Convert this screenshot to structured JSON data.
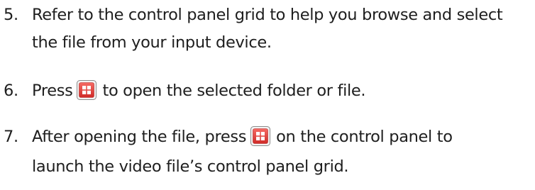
{
  "steps": [
    {
      "number": "5.",
      "lines": [
        "Refer to the control panel grid to help you browse and select",
        "the file from your input device."
      ]
    },
    {
      "number": "6.",
      "before_icon": "Press",
      "after_icon": "to open the selected folder or file.",
      "icon": "grid-button-icon"
    },
    {
      "number": "7.",
      "before_icon": "After opening the file, press",
      "after_icon": "on the control panel to",
      "line2": "launch the video file’s control panel grid.",
      "icon": "grid-button-icon"
    }
  ],
  "colors": {
    "text": "#1e1e1e",
    "icon_red": "#e23a36",
    "icon_gray": "#8a8a8a"
  }
}
